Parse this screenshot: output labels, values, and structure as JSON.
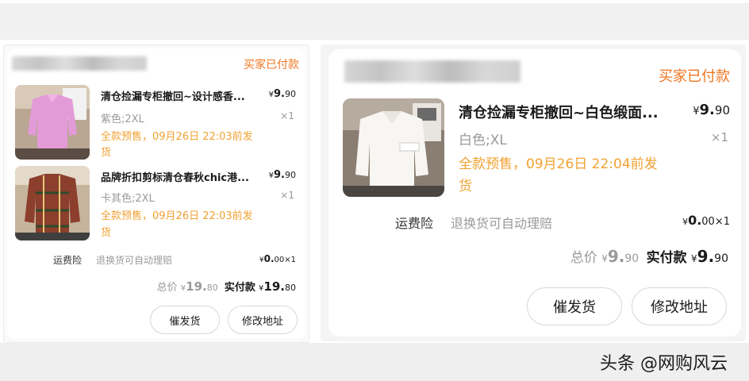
{
  "watermark": "头条 @网购风云",
  "left_order": {
    "status": "买家已付款",
    "items": [
      {
        "title": "清仓捡漏专柜撤回~设计感香...",
        "price_symbol": "¥",
        "price_int": "9.",
        "price_dec": "90",
        "spec": "紫色;2XL",
        "qty": "×1",
        "presale_line1": "全款预售，09月26日 22:03前发",
        "presale_line2": "货"
      },
      {
        "title": "品牌折扣剪标清仓春秋chic港...",
        "price_symbol": "¥",
        "price_int": "9.",
        "price_dec": "90",
        "spec": "卡其色;2XL",
        "qty": "×1",
        "presale_line1": "全款预售，09月26日 22:03前发",
        "presale_line2": "货"
      }
    ],
    "insurance": {
      "label": "运费险",
      "desc": "退换货可自动理赔",
      "price_symbol": "¥",
      "price_int": "0.",
      "price_dec": "00",
      "qty": "×1"
    },
    "total": {
      "label": "总价",
      "symbol": "¥",
      "total_int": "19.",
      "total_dec": "80",
      "paid_label": "实付款",
      "paid_int": "19.",
      "paid_dec": "80"
    },
    "buttons": {
      "urge": "催发货",
      "modify": "修改地址"
    }
  },
  "right_order": {
    "status": "买家已付款",
    "items": [
      {
        "title": "清仓捡漏专柜撤回~白色缎面...",
        "price_symbol": "¥",
        "price_int": "9.",
        "price_dec": "90",
        "spec": "白色;XL",
        "qty": "×1",
        "presale_line1": "全款预售，09月26日 22:04前发",
        "presale_line2": "货"
      }
    ],
    "insurance": {
      "label": "运费险",
      "desc": "退换货可自动理赔",
      "price_symbol": "¥",
      "price_int": "0.",
      "price_dec": "00",
      "qty": "×1"
    },
    "total": {
      "label": "总价",
      "symbol": "¥",
      "total_int": "9.",
      "total_dec": "90",
      "paid_label": "实付款",
      "paid_int": "9.",
      "paid_dec": "90"
    },
    "buttons": {
      "urge": "催发货",
      "modify": "修改地址"
    }
  }
}
